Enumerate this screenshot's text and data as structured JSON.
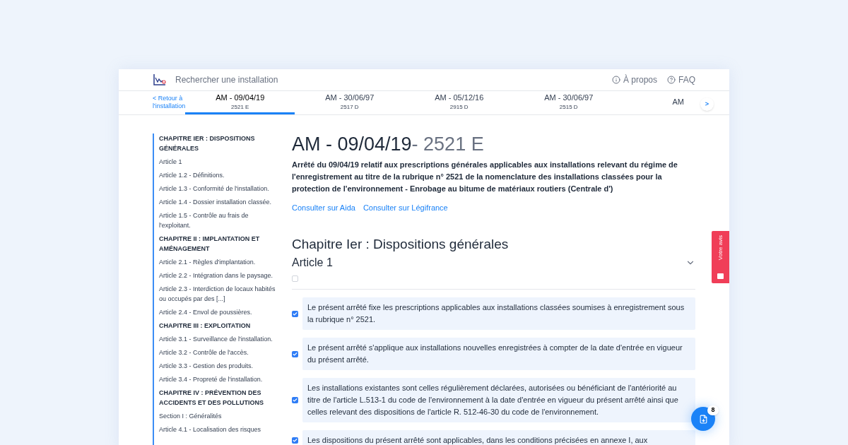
{
  "header": {
    "search_label": "Rechercher une installation",
    "links": [
      {
        "kind": "info",
        "label": "À propos"
      },
      {
        "kind": "help",
        "label": "FAQ"
      }
    ]
  },
  "nav": {
    "back": "< Retour à l'installation",
    "tabs": [
      {
        "title": "AM - 09/04/19",
        "code": "2521 E",
        "selected": true
      },
      {
        "title": "AM - 30/06/97",
        "code": "2517 D",
        "selected": false
      },
      {
        "title": "AM - 05/12/16",
        "code": "2915 D",
        "selected": false
      },
      {
        "title": "AM - 30/06/97",
        "code": "2515 D",
        "selected": false
      },
      {
        "title": "AM",
        "selected": false
      }
    ],
    "next": ">"
  },
  "sidebar": [
    {
      "kind": "chapter",
      "label": "CHAPITRE IER : DISPOSITIONS GÉNÉRALES"
    },
    {
      "kind": "article",
      "label": "Article 1"
    },
    {
      "kind": "article",
      "label": "Article 1.2 - Définitions."
    },
    {
      "kind": "article",
      "label": "Article 1.3 - Conformité de l'installation."
    },
    {
      "kind": "article",
      "label": "Article 1.4 - Dossier installation classée."
    },
    {
      "kind": "article",
      "label": "Article 1.5 - Contrôle au frais de l'exploitant."
    },
    {
      "kind": "chapter",
      "label": "CHAPITRE II : IMPLANTATION ET AMÉNAGEMENT"
    },
    {
      "kind": "article",
      "label": "Article 2.1 - Règles d'implantation."
    },
    {
      "kind": "article",
      "label": "Article 2.2 - Intégration dans le paysage."
    },
    {
      "kind": "article",
      "label": "Article 2.3 - Interdiction de locaux habités ou occupés par des [...]"
    },
    {
      "kind": "article",
      "label": "Article 2.4 - Envol de poussières."
    },
    {
      "kind": "chapter",
      "label": "CHAPITRE III : EXPLOITATION"
    },
    {
      "kind": "article",
      "label": "Article 3.1 - Surveillance de l'installation."
    },
    {
      "kind": "article",
      "label": "Article 3.2 - Contrôle de l'accès."
    },
    {
      "kind": "article",
      "label": "Article 3.3 - Gestion des produits."
    },
    {
      "kind": "article",
      "label": "Article 3.4 - Propreté de l'installation."
    },
    {
      "kind": "chapter",
      "label": "CHAPITRE IV : PRÉVENTION DES ACCIDENTS ET DES POLLUTIONS"
    },
    {
      "kind": "article",
      "label": "Section I : Généralités"
    },
    {
      "kind": "article",
      "label": "Article 4.1 - Localisation des risques"
    }
  ],
  "document": {
    "title": "AM - 09/04/19",
    "code": "- 2521 E",
    "description": "Arrêté du 09/04/19 relatif aux prescriptions générales applicables aux installations relevant du régime de l'enregistrement au titre de la rubrique n° 2521 de la nomenclature des installations classées pour la protection de l'environnement - Enrobage au bitume de matériaux routiers (Centrale d')",
    "links": [
      "Consulter sur Aida",
      "Consulter sur Légifrance"
    ],
    "chapter": "Chapitre Ier : Dispositions générales",
    "article": {
      "title": "Article 1",
      "checked": false,
      "expanded": true
    },
    "paragraphs": [
      {
        "text": "Le présent arrêté fixe les prescriptions applicables aux installations classées soumises à enregistrement sous la rubrique n° 2521.",
        "checked": true
      },
      {
        "text": "Le présent arrêté s'applique aux installations nouvelles enregistrées à compter de la date d'entrée en vigueur du présent arrêté.",
        "checked": true
      },
      {
        "text": "Les installations existantes sont celles régulièrement déclarées, autorisées ou bénéficiant de l'antériorité au titre de l'article L.513-1 du code de l'environnement à la date d'entrée en vigueur du présent arrêté ainsi que celles relevant des dispositions de l'article R. 512-46-30 du code de l'environnement.",
        "checked": true
      },
      {
        "text": "Les dispositions du présent arrêté sont applicables, dans les conditions précisées en annexe I, aux",
        "checked": true
      }
    ]
  },
  "feedback": "Votre avis",
  "download": {
    "count": "8"
  }
}
